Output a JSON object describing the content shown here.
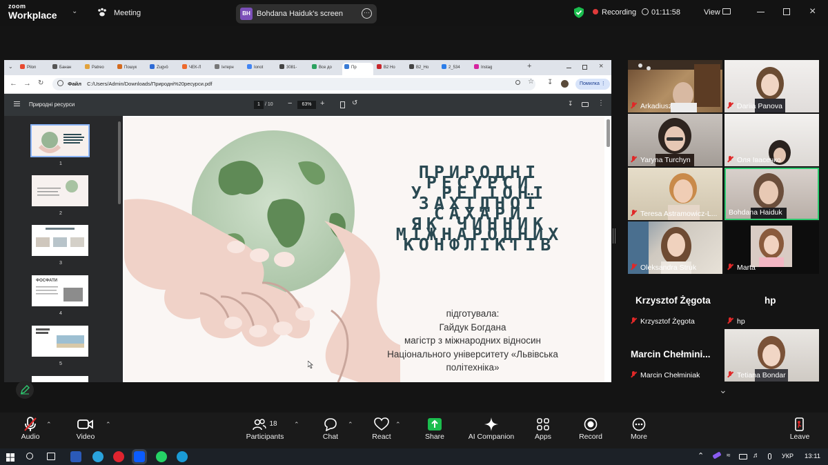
{
  "app": {
    "brand_top": "zoom",
    "brand_bottom": "Workplace",
    "meeting_label": "Meeting"
  },
  "screen_pill": {
    "initials": "BH",
    "label": "Bohdana Haiduk's screen"
  },
  "status": {
    "recording": "Recording",
    "timer": "01:11:58",
    "view": "View"
  },
  "browser": {
    "tabs": [
      "Pilon",
      "Банан",
      "Patreo",
      "Пошук",
      "Zugvö",
      "ЧЕК-Л",
      "Інтерн",
      "Ionot",
      "3081-",
      "Все до",
      "Пр",
      "B2 Ho",
      "B2_Ho",
      "2_534",
      "Instag"
    ],
    "active_tab_index": 10,
    "url_label": "Файл",
    "url": "C:/Users/Admin/Downloads/Природні%20ресурси.pdf",
    "error_button": "Помилка"
  },
  "pdf": {
    "title": "Природні ресурси",
    "page_current": "1",
    "page_total": "/ 10",
    "zoom": "63%",
    "thumb_numbers": [
      "1",
      "2",
      "3",
      "4",
      "5"
    ],
    "thumb3_caption": "ФОСФАТИ"
  },
  "slide": {
    "title_lines": [
      "ПРИРОДНІ",
      "РЕСУРСИ",
      "У РЕГІОНІ",
      "ЗАХІДНОЇ САХАРИ",
      "ЯК ЧИННИК",
      "МІЖНАРОДНИХ",
      "КОНФЛІКТІВ"
    ],
    "author_lines": [
      "підготувала:",
      "Гайдук Богдана",
      "магістр з міжнародних відносин",
      "Національного університету «Львівська",
      "політехніка»"
    ]
  },
  "participants": [
    {
      "name": "Arkadiusz"
    },
    {
      "name": "Dariia Panova"
    },
    {
      "name": "Yaryna Turchyn"
    },
    {
      "name": "Оля Івасечко"
    },
    {
      "name": "Teresa Astramowicz-L..."
    },
    {
      "name": "Bohdana Haiduk"
    },
    {
      "name": "Oleksandra Struk"
    },
    {
      "name": "Marta"
    },
    {
      "name": "Krzysztof Żęgota",
      "big": "Krzysztof Żęgota"
    },
    {
      "name": "hp",
      "big": "hp"
    },
    {
      "name": "Marcin Chełminiak",
      "big": "Marcin  Chełmini..."
    },
    {
      "name": "Tetiana Bondar"
    }
  ],
  "toolbar": {
    "audio": "Audio",
    "video": "Video",
    "participants": "Participants",
    "participants_count": "18",
    "chat": "Chat",
    "react": "React",
    "share": "Share",
    "ai": "AI Companion",
    "apps": "Apps",
    "record": "Record",
    "more": "More",
    "leave": "Leave"
  },
  "taskbar": {
    "lang": "УКР",
    "time": "13:11"
  },
  "colors": {
    "accent_green": "#1bbd4e",
    "active_speaker": "#2ecc71",
    "brand_blue": "#0b5cff"
  }
}
